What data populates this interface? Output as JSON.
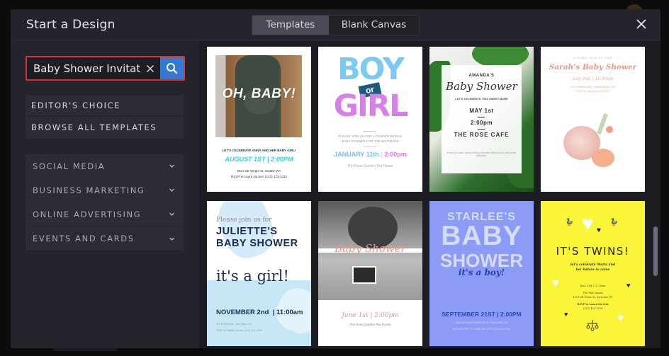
{
  "dialog": {
    "title": "Start a Design",
    "tabs": [
      {
        "label": "Templates",
        "active": true
      },
      {
        "label": "Blank Canvas",
        "active": false
      }
    ],
    "close_icon": "close-icon"
  },
  "search": {
    "value": "Baby Shower Invitat",
    "placeholder": "",
    "clear_icon": "close-icon",
    "submit_icon": "search-icon",
    "highlight_color": "#d8322a",
    "button_color": "#3479d4"
  },
  "sidebar": {
    "primary": [
      {
        "label": "EDITOR'S CHOICE"
      },
      {
        "label": "BROWSE ALL TEMPLATES"
      }
    ],
    "categories": [
      {
        "label": "SOCIAL MEDIA",
        "icon": "chevron-down-icon"
      },
      {
        "label": "BUSINESS MARKETING",
        "icon": "chevron-down-icon"
      },
      {
        "label": "ONLINE ADVERTISING",
        "icon": "chevron-down-icon"
      },
      {
        "label": "EVENTS AND CARDS",
        "icon": "chevron-down-icon"
      }
    ]
  },
  "templates": [
    {
      "name": "oh-baby",
      "headline": "OH, BABY!",
      "line1": "LET'S CELEBRATE ANNA AND HER BABY GIRL!",
      "date": "AUGUST 1ST | 2:00PM",
      "line2": "5612 SE Wright St, Seattle WA",
      "line3": "RSVP to Laura via text: (123) 123-1234"
    },
    {
      "name": "boy-or-girl",
      "word1": "BOY",
      "badge": "or",
      "word2": "GIRL",
      "line1": "PLEASE JOIN US FOR A GENDER REVEAL",
      "line1b": "BABY SHOWER FOR THE WHITMANS",
      "date_a": "JANUARY 11th",
      "date_b": "2:00pm",
      "line2": "The Rose Garden Tea House"
    },
    {
      "name": "amandas-baby-shower",
      "eyebrow": "AMANDA'S",
      "script": "Baby Shower",
      "tagline": "LET'S CELEBRATE THIS SWEET BABE",
      "date": "MAY 1st",
      "time": "2:00pm",
      "venue": "THE ROSE CAFE",
      "note": "In lieu of a card, please bring a favorite baby book to add to the collection."
    },
    {
      "name": "sarahs-baby-shower",
      "eyebrow": "PLEASE JOIN US FOR",
      "script": "Sarah's Baby Shower",
      "date": "July 2nd | 11:00am",
      "line2": "31 N Sunshine Way, Cannon Beach, OR",
      "line3": "RSVP to Julia (123) 123-1234"
    },
    {
      "name": "juliettes-baby-shower",
      "eyebrow": "Please join us for",
      "title1": "JULIETTE'S",
      "title2": "BABY SHOWER",
      "script": "it's a girl!",
      "date": "NOVEMBER 2nd  | 11:00am",
      "line2": "123 N Rose Ave, San Diego CA",
      "line3": "RSVP to Raleigh via text: (123) 123-1234"
    },
    {
      "name": "baby-shower-photo",
      "script": "Baby Shower",
      "date": "June 1st | 2:00pm",
      "line2": "The Rose Garden Tea House"
    },
    {
      "name": "starlees-baby-shower",
      "title1": "STARLEE'S",
      "title2": "BABY",
      "title3": "SHOWER",
      "script": "it's a boy!",
      "date": "SEPTEMBER 21ST | 2:00PM",
      "line2": "5432 NE HAWTHORNE BLVD, PORTLAND OR",
      "line3": "PLEASE RSVP TO SARA VIA TEXT: (123) 123-1234"
    },
    {
      "name": "its-twins",
      "title": "IT'S TWINS!",
      "line1": "let's celebrate Maria and",
      "line1b": "her babies to come",
      "date": "June 21st | 11:30am",
      "venue": "The Pine Annex",
      "address": "1111 SE Grant St, Syracuse NY",
      "rsvp": "RSVP to Laura via text",
      "phone": "(123) 123-1234"
    }
  ],
  "scroll": {
    "position_fraction": 0.62
  }
}
